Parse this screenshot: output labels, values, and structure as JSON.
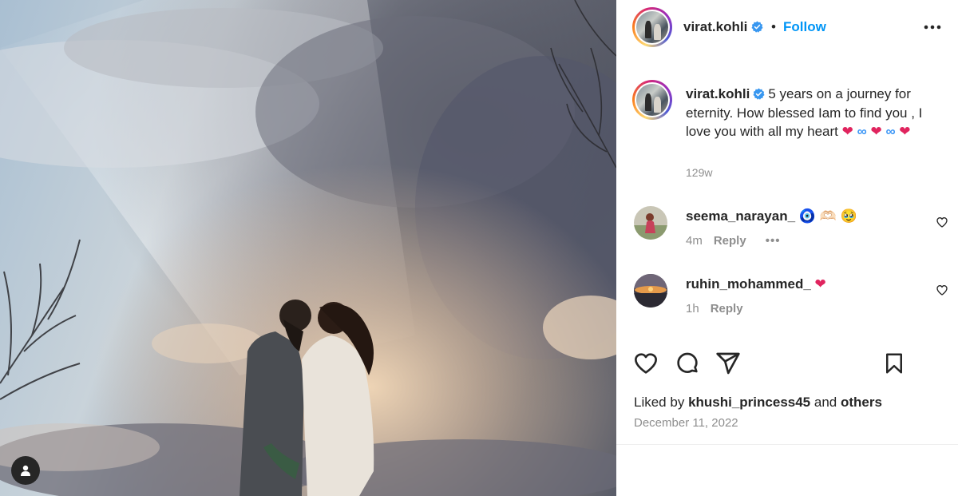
{
  "post": {
    "username": "virat.kohli",
    "follow_label": "Follow",
    "separator": "•"
  },
  "caption": {
    "username": "virat.kohli",
    "text": "5 years on a journey for eternity. How blessed Iam to find you , I love you with all my heart",
    "emoji_trail": [
      "❤",
      "∞",
      "❤",
      "∞",
      "❤"
    ],
    "time": "129w"
  },
  "comments": [
    {
      "username": "seema_narayan_",
      "text": "🧿 🫶🏻 🥹",
      "time": "4m",
      "reply_label": "Reply",
      "more": "•••"
    },
    {
      "username": "ruhin_mohammed_",
      "text": "❤",
      "time": "1h",
      "reply_label": "Reply"
    }
  ],
  "footer": {
    "liked_prefix": "Liked by",
    "liked_user": "khushi_princess45",
    "liked_and": "and",
    "liked_others": "others",
    "date": "December 11, 2022"
  },
  "icons": {
    "verified": "verified-badge-icon",
    "more": "more-options-icon",
    "like": "heart-icon",
    "comment": "comment-icon",
    "share": "share-icon",
    "save": "bookmark-icon",
    "user_tag": "user-tag-icon"
  },
  "colors": {
    "accent": "#0095f6",
    "text": "#262626",
    "muted": "#8e8e8e",
    "heart": "#e0245e"
  }
}
